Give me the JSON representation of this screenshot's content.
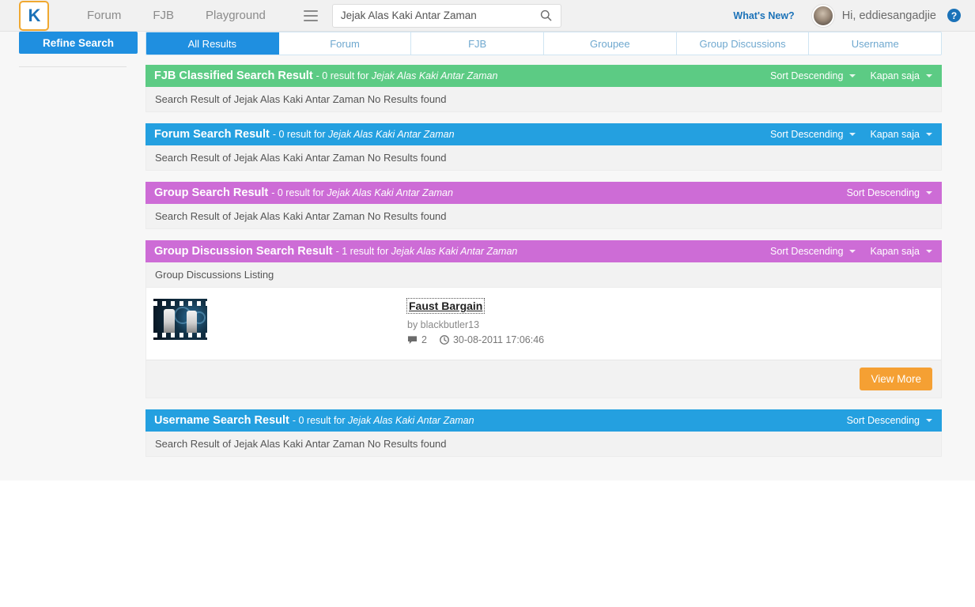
{
  "header": {
    "logo_label": "K",
    "nav": [
      {
        "label": "Forum"
      },
      {
        "label": "FJB"
      },
      {
        "label": "Playground"
      }
    ],
    "menu_icon": "hamburger-icon",
    "search": {
      "value": "Jejak Alas Kaki Antar Zaman",
      "placeholder": "Search",
      "icon": "search-icon"
    },
    "whats_new": "What's New?",
    "greeting": "Hi, eddiesangadjie",
    "help_label": "?"
  },
  "tabbar": {
    "refine_label": "Refine Search",
    "tabs": [
      {
        "label": "All Results",
        "active": true
      },
      {
        "label": "Forum",
        "active": false
      },
      {
        "label": "FJB",
        "active": false
      },
      {
        "label": "Groupee",
        "active": false
      },
      {
        "label": "Group Discussions",
        "active": false
      },
      {
        "label": "Username",
        "active": false
      }
    ]
  },
  "search_term": "Jejak Alas Kaki Antar Zaman",
  "controls": {
    "sort_label": "Sort Descending",
    "time_label": "Kapan saja"
  },
  "sections": [
    {
      "id": "fjb-classified",
      "title": "FJB Classified Search Result",
      "count_text": "- 0 result for",
      "term": "Jejak Alas Kaki Antar Zaman",
      "color": "#5ccb84",
      "sort_label": "Sort Descending",
      "time_label": "Kapan saja",
      "has_time": true,
      "empty_text": "Search Result of Jejak Alas Kaki Antar Zaman No Results found"
    },
    {
      "id": "forum",
      "title": "Forum Search Result",
      "count_text": "- 0 result for",
      "term": "Jejak Alas Kaki Antar Zaman",
      "color": "#24a0e0",
      "sort_label": "Sort Descending",
      "time_label": "Kapan saja",
      "has_time": true,
      "empty_text": "Search Result of Jejak Alas Kaki Antar Zaman No Results found"
    },
    {
      "id": "group",
      "title": "Group Search Result",
      "count_text": "- 0 result for",
      "term": "Jejak Alas Kaki Antar Zaman",
      "color": "#cd6cd6",
      "sort_label": "Sort Descending",
      "time_label": "",
      "has_time": false,
      "empty_text": "Search Result of Jejak Alas Kaki Antar Zaman No Results found"
    },
    {
      "id": "group-discussion",
      "title": "Group Discussion Search Result",
      "count_text": "- 1 result for",
      "term": "Jejak Alas Kaki Antar Zaman",
      "color": "#cd6cd6",
      "sort_label": "Sort Descending",
      "time_label": "Kapan saja",
      "has_time": true,
      "listing_label": "Group Discussions Listing",
      "result": {
        "thumbnail_alt": "discussion-thumbnail",
        "title": "Faust Bargain",
        "author": "by blackbutler13",
        "comment_count": "2",
        "timestamp": "30-08-2011 17:06:46"
      },
      "view_more_label": "View More"
    },
    {
      "id": "username",
      "title": "Username Search Result",
      "count_text": "- 0 result for",
      "term": "Jejak Alas Kaki Antar Zaman",
      "color": "#24a0e0",
      "sort_label": "Sort Descending",
      "time_label": "",
      "has_time": false,
      "empty_text": "Search Result of Jejak Alas Kaki Antar Zaman No Results found"
    }
  ]
}
